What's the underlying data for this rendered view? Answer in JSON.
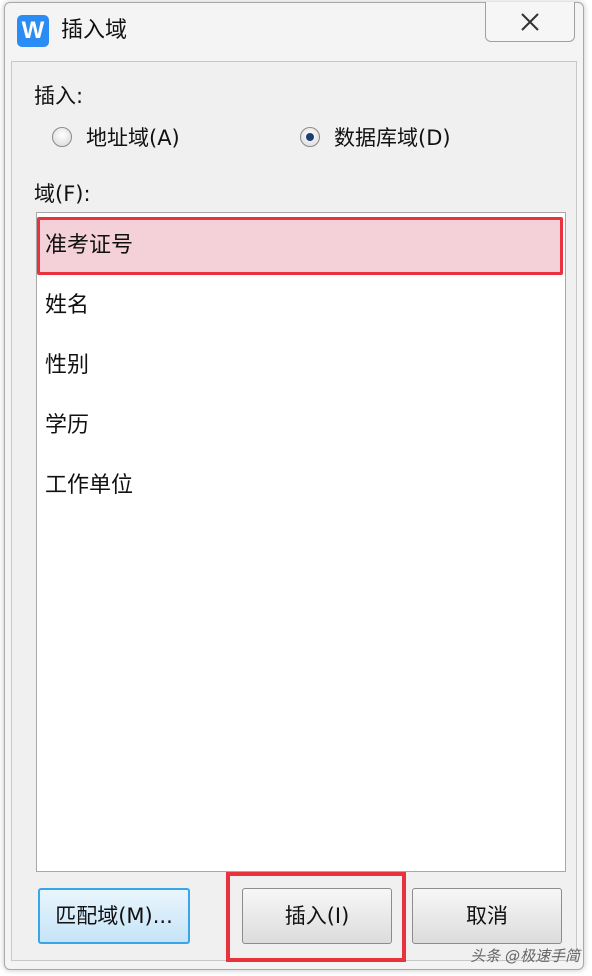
{
  "window": {
    "title": "插入域",
    "app_icon_letter": "W"
  },
  "insert_section": {
    "label": "插入:",
    "options": [
      {
        "label": "地址域(A)",
        "checked": false
      },
      {
        "label": "数据库域(D)",
        "checked": true
      }
    ]
  },
  "fields_section": {
    "label": "域(F):",
    "items": [
      "准考证号",
      "姓名",
      "性别",
      "学历",
      "工作单位"
    ],
    "selected": "准考证号"
  },
  "buttons": {
    "match": "匹配域(M)...",
    "insert": "插入(I)",
    "cancel": "取消"
  },
  "watermark": "头条 @极速手简",
  "colors": {
    "accent": "#2b8cf6",
    "highlight_border": "#e8323c",
    "highlight_fill": "#f4d0d9",
    "focus_border": "#3aa6ea"
  }
}
